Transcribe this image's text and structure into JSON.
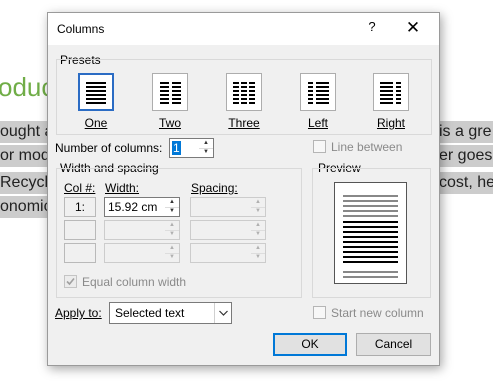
{
  "background": {
    "heading": "oduc",
    "lines_left": [
      "ought a",
      "or mod",
      "Recycl",
      "onomic"
    ],
    "lines_right": [
      "is a gre",
      "er goes",
      "cost, he",
      ""
    ]
  },
  "dialog": {
    "title": "Columns",
    "help_label": "?",
    "close_label": "✕",
    "presets": {
      "label": "Presets",
      "items": [
        {
          "label": "One",
          "columns": 1,
          "selected": true
        },
        {
          "label": "Two",
          "columns": 2,
          "selected": false
        },
        {
          "label": "Three",
          "columns": 3,
          "selected": false
        },
        {
          "label": "Left",
          "columns": 2,
          "selected": false
        },
        {
          "label": "Right",
          "columns": 2,
          "selected": false
        }
      ]
    },
    "number_of_columns": {
      "label": "Number of columns:",
      "value": "1"
    },
    "line_between": {
      "label": "Line between",
      "checked": false
    },
    "width_spacing": {
      "label": "Width and spacing",
      "col_header": "Col #:",
      "width_header": "Width:",
      "spacing_header": "Spacing:",
      "rows": [
        {
          "col": "1:",
          "width": "15.92 cm",
          "spacing": ""
        },
        {
          "col": "",
          "width": "",
          "spacing": ""
        },
        {
          "col": "",
          "width": "",
          "spacing": ""
        }
      ],
      "equal_width_label": "Equal column width",
      "equal_width_checked": true
    },
    "preview": {
      "label": "Preview"
    },
    "apply_to": {
      "label": "Apply to:",
      "value": "Selected text"
    },
    "start_new_column": {
      "label": "Start new column",
      "checked": false
    },
    "buttons": {
      "ok": "OK",
      "cancel": "Cancel"
    },
    "colors": {
      "accent": "#0078d7",
      "selected_border": "#2b6cc4",
      "doc_heading": "#70ad47"
    }
  }
}
